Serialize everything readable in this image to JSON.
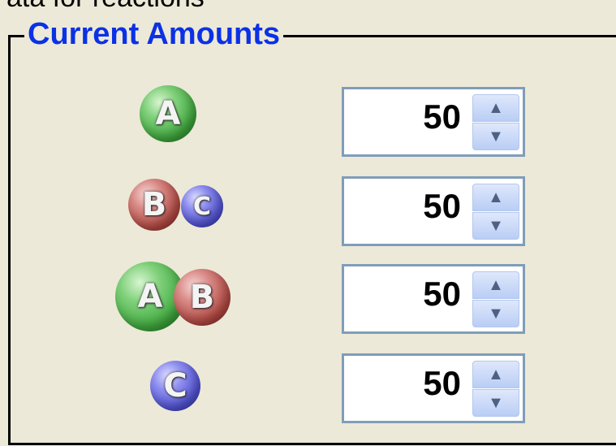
{
  "header": {
    "partial_text": "ata for reactions"
  },
  "panel": {
    "title": "Current Amounts"
  },
  "rows": [
    {
      "icons": [
        "A"
      ],
      "value": "50"
    },
    {
      "icons": [
        "B",
        "C"
      ],
      "value": "50"
    },
    {
      "icons": [
        "A",
        "B"
      ],
      "value": "50"
    },
    {
      "icons": [
        "C"
      ],
      "value": "50"
    }
  ],
  "colors": {
    "A": "#3ea83c",
    "B": "#b54842",
    "C": "#5252d8",
    "title": "#0b31e6",
    "spinner_border": "#7f9db9",
    "background": "#ece9d8"
  },
  "icons": {
    "spin_up": "chevron-up-icon",
    "spin_down": "chevron-down-icon"
  }
}
